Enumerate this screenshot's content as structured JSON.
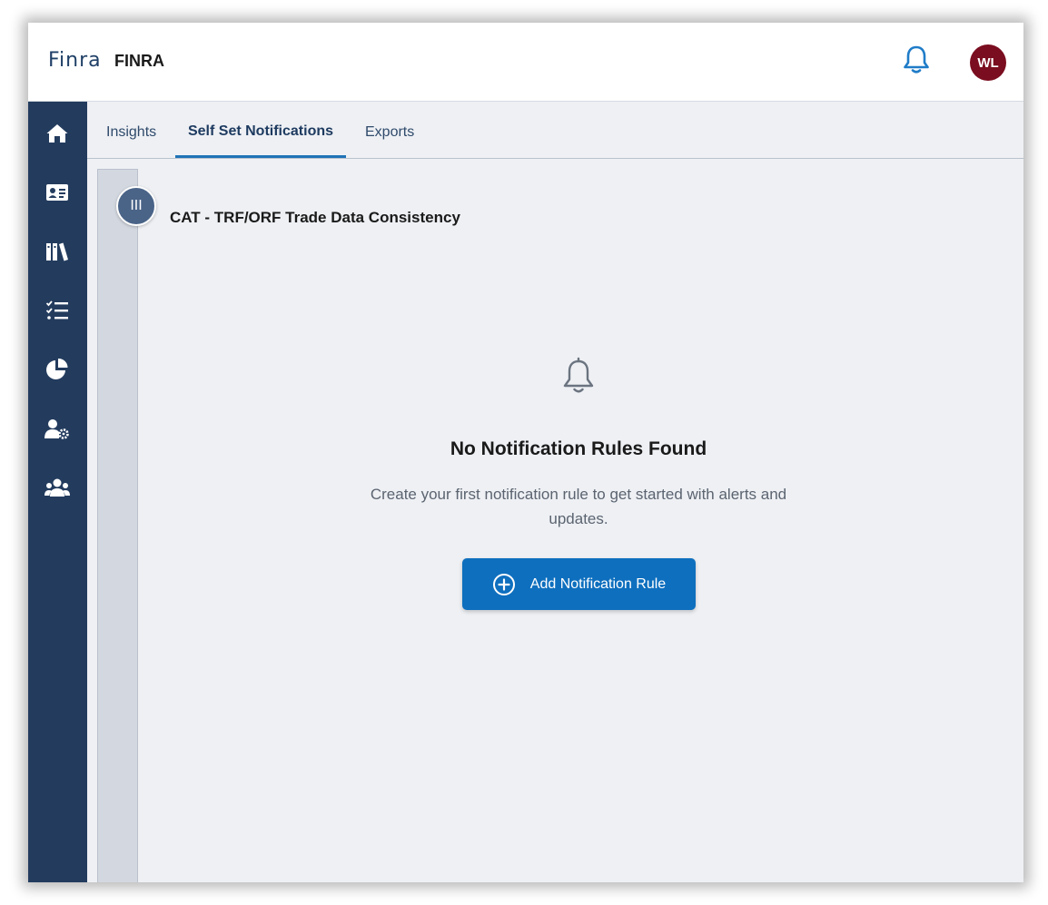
{
  "header": {
    "logo_text": "FINRA",
    "logo_mark": "Finra",
    "brand_title": "FINRA",
    "notification_icon": "bell-icon",
    "avatar_initials": "WL",
    "avatar_color": "#7a0d1f"
  },
  "sidebar": {
    "items": [
      {
        "name": "home",
        "icon": "home-icon"
      },
      {
        "name": "profile-card",
        "icon": "id-card-icon"
      },
      {
        "name": "library",
        "icon": "library-icon"
      },
      {
        "name": "checklist",
        "icon": "checklist-icon"
      },
      {
        "name": "analytics",
        "icon": "pie-chart-icon"
      },
      {
        "name": "user-settings",
        "icon": "user-gear-icon"
      },
      {
        "name": "users",
        "icon": "users-icon"
      }
    ],
    "background": "#233c5e"
  },
  "tabs": {
    "items": [
      {
        "label": "Insights",
        "active": false
      },
      {
        "label": "Self Set Notifications",
        "active": true
      },
      {
        "label": "Exports",
        "active": false
      }
    ]
  },
  "panel": {
    "collapse_label": "III",
    "section_title": "CAT - TRF/ORF Trade Data Consistency"
  },
  "empty_state": {
    "icon": "bell-icon",
    "title": "No Notification Rules Found",
    "description": "Create your first notification rule to get started with alerts and updates.",
    "add_button_label": "Add Notification Rule",
    "add_button_color": "#0e6fbe"
  }
}
